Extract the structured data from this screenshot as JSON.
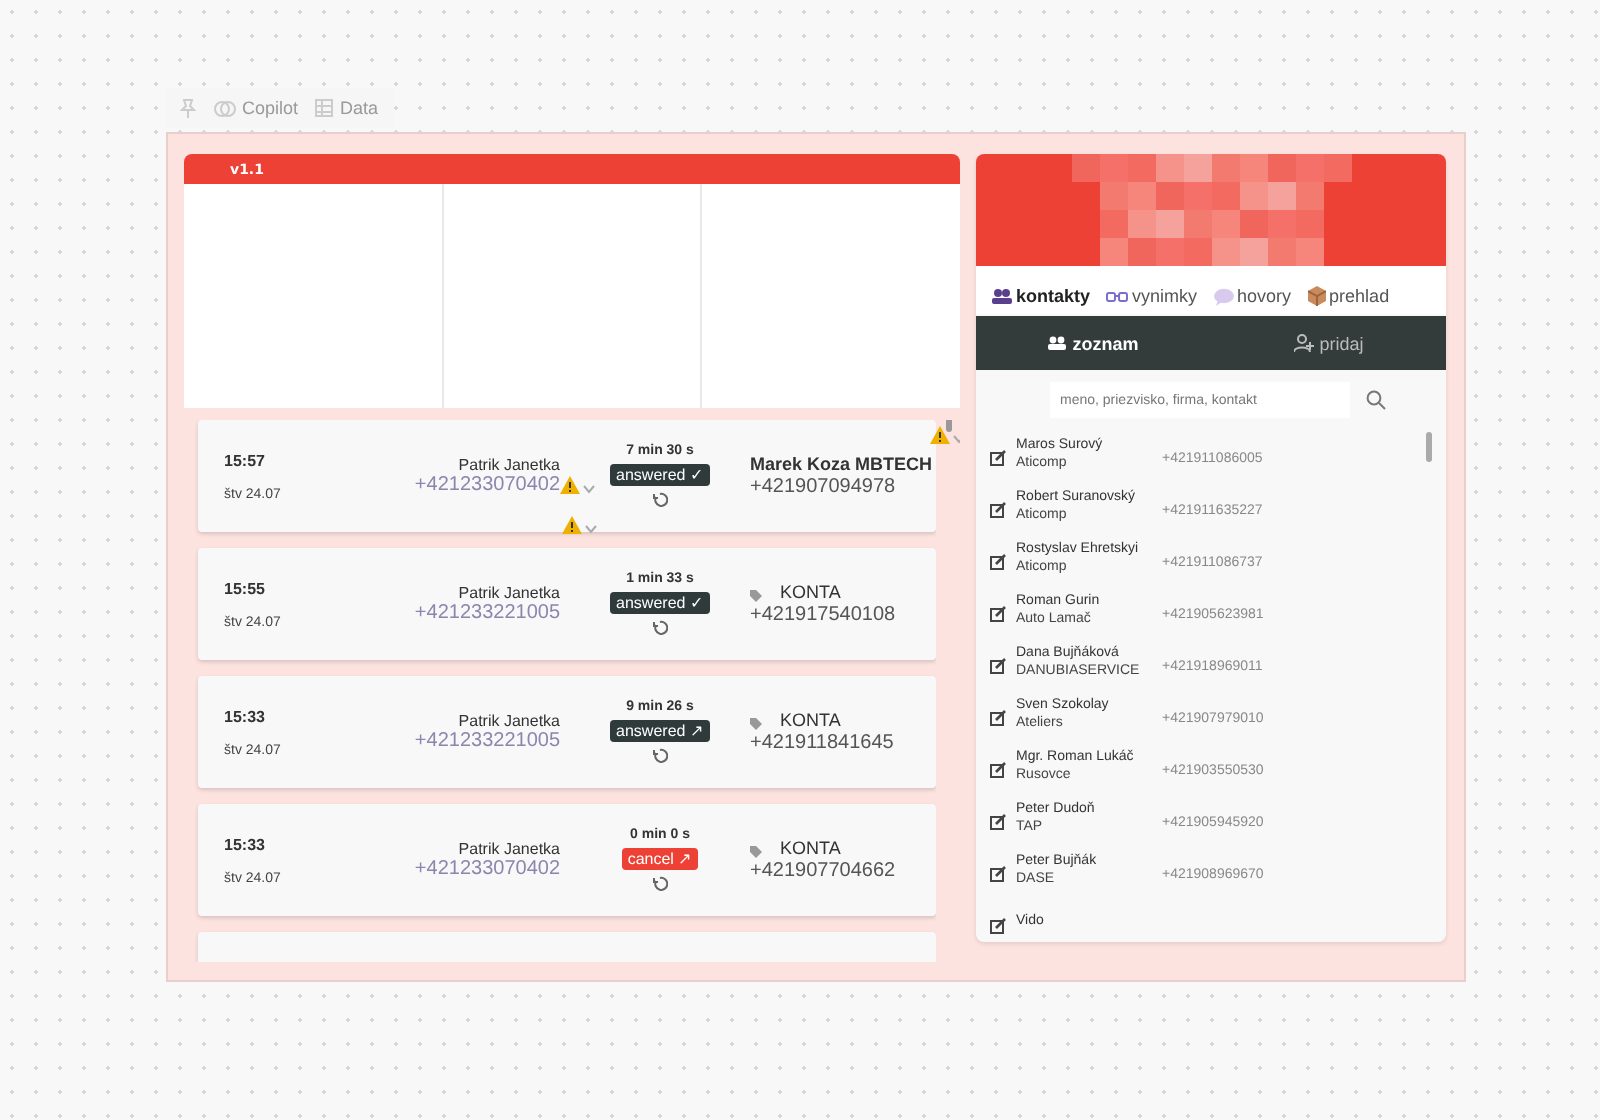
{
  "toolbar": [
    {
      "kind": "pin"
    },
    {
      "kind": "copilot",
      "label": "Copilot"
    },
    {
      "kind": "data",
      "label": "Data"
    }
  ],
  "left": {
    "version": "v1.1",
    "calls": [
      {
        "time": "15:57",
        "date": "štv 24.07",
        "caller": "Patrik Janetka",
        "caller_number": "+421233070402",
        "warning": true,
        "duration": "7 min 30 s",
        "kind": "answered",
        "status": "answered",
        "status_mark": "✓",
        "callee": "Marek Koza MBTECH",
        "callee_tag": false,
        "callee_number": "+421907094978"
      },
      {
        "time": "15:55",
        "date": "štv 24.07",
        "caller": "Patrik Janetka",
        "caller_number": "+421233221005",
        "warning": false,
        "duration": "1 min 33 s",
        "kind": "answered",
        "status": "answered",
        "status_mark": "✓",
        "callee": "KONTA",
        "callee_tag": true,
        "callee_number": "+421917540108"
      },
      {
        "time": "15:33",
        "date": "štv 24.07",
        "caller": "Patrik Janetka",
        "caller_number": "+421233221005",
        "warning": false,
        "duration": "9 min 26 s",
        "kind": "answered",
        "status": "answered",
        "status_mark": "↗",
        "callee": "KONTA",
        "callee_tag": true,
        "callee_number": "+421911841645"
      },
      {
        "time": "15:33",
        "date": "štv 24.07",
        "caller": "Patrik Janetka",
        "caller_number": "+421233070402",
        "warning": false,
        "duration": "0 min 0 s",
        "kind": "cancel",
        "status": "cancel",
        "status_mark": "↗",
        "callee": "KONTA",
        "callee_tag": true,
        "callee_number": "+421907704662"
      }
    ]
  },
  "right": {
    "tabs": [
      {
        "kind": "contacts",
        "label": "kontakty",
        "selected": true
      },
      {
        "kind": "exceptions",
        "label": "vynimky",
        "selected": false
      },
      {
        "kind": "calls",
        "label": "hovory",
        "selected": false
      },
      {
        "kind": "overview",
        "label": "prehlad",
        "selected": false
      }
    ],
    "subtabs": [
      {
        "kind": "list",
        "label": "zoznam",
        "selected": true
      },
      {
        "kind": "add",
        "label": "pridaj",
        "selected": false
      }
    ],
    "search": {
      "placeholder": "meno, priezvisko, firma, kontakt"
    },
    "contacts": [
      {
        "name": "Maros Surový",
        "company": "Aticomp",
        "phone": "+421911086005"
      },
      {
        "name": "Robert Suranovský",
        "company": "Aticomp",
        "phone": "+421911635227"
      },
      {
        "name": "Rostyslav Ehretskyi",
        "company": "Aticomp",
        "phone": "+421911086737"
      },
      {
        "name": "Roman Gurin",
        "company": "Auto Lamač",
        "phone": "+421905623981"
      },
      {
        "name": "Dana Bujňáková",
        "company": "DANUBIASERVICE",
        "phone": "+421918969011"
      },
      {
        "name": "Sven Szokolay",
        "company": "Ateliers",
        "phone": "+421907979010"
      },
      {
        "name": "Mgr. Roman Lukáč",
        "company": "Rusovce",
        "phone": "+421903550530"
      },
      {
        "name": "Peter Dudoň",
        "company": "TAP",
        "phone": "+421905945920"
      },
      {
        "name": "Peter Bujňák",
        "company": "DASE",
        "phone": "+421908969670"
      },
      {
        "name": "Vido"
      }
    ]
  }
}
